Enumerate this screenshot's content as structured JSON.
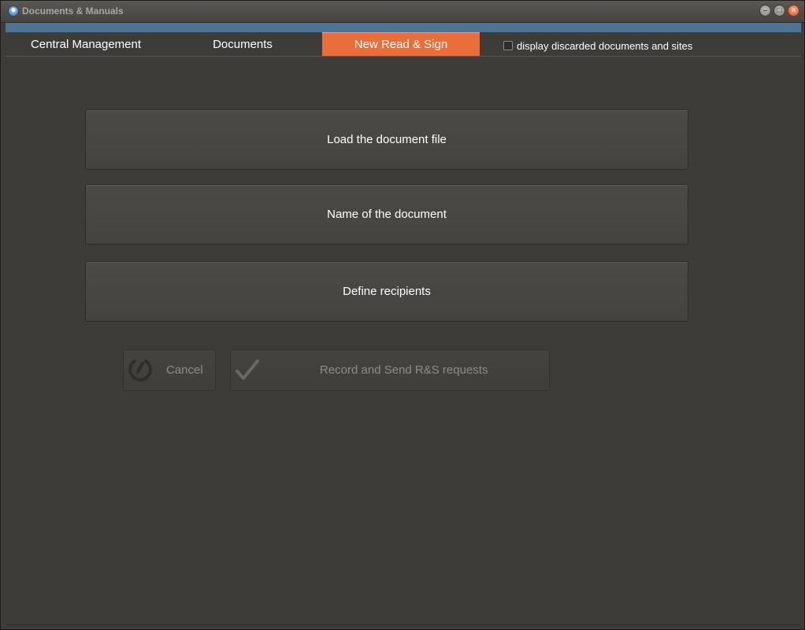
{
  "window": {
    "title": "Documents & Manuals",
    "controls": {
      "minimize_icon": "minimize-icon",
      "maximize_icon": "maximize-icon",
      "close_icon": "close-icon"
    }
  },
  "tabs": [
    {
      "label": "Central Management",
      "active": false
    },
    {
      "label": "Documents",
      "active": false
    },
    {
      "label": "New Read & Sign",
      "active": true
    }
  ],
  "discard_option": {
    "label": "display discarded documents and sites",
    "checked": false
  },
  "steps": [
    {
      "label": "Load the document file"
    },
    {
      "label": "Name of the document"
    },
    {
      "label": "Define recipients"
    }
  ],
  "actions": {
    "cancel": {
      "label": "Cancel",
      "icon": "cancel-icon",
      "enabled": false
    },
    "record_send": {
      "label": "Record and Send R&S requests",
      "icon": "checkmark-icon",
      "enabled": false
    }
  },
  "colors": {
    "accent_tab": "#ea6e3b",
    "header_bar": "#4d7494",
    "background": "#3e3c38",
    "button_face": "#4a4844",
    "disabled_text": "#8e8c87"
  }
}
